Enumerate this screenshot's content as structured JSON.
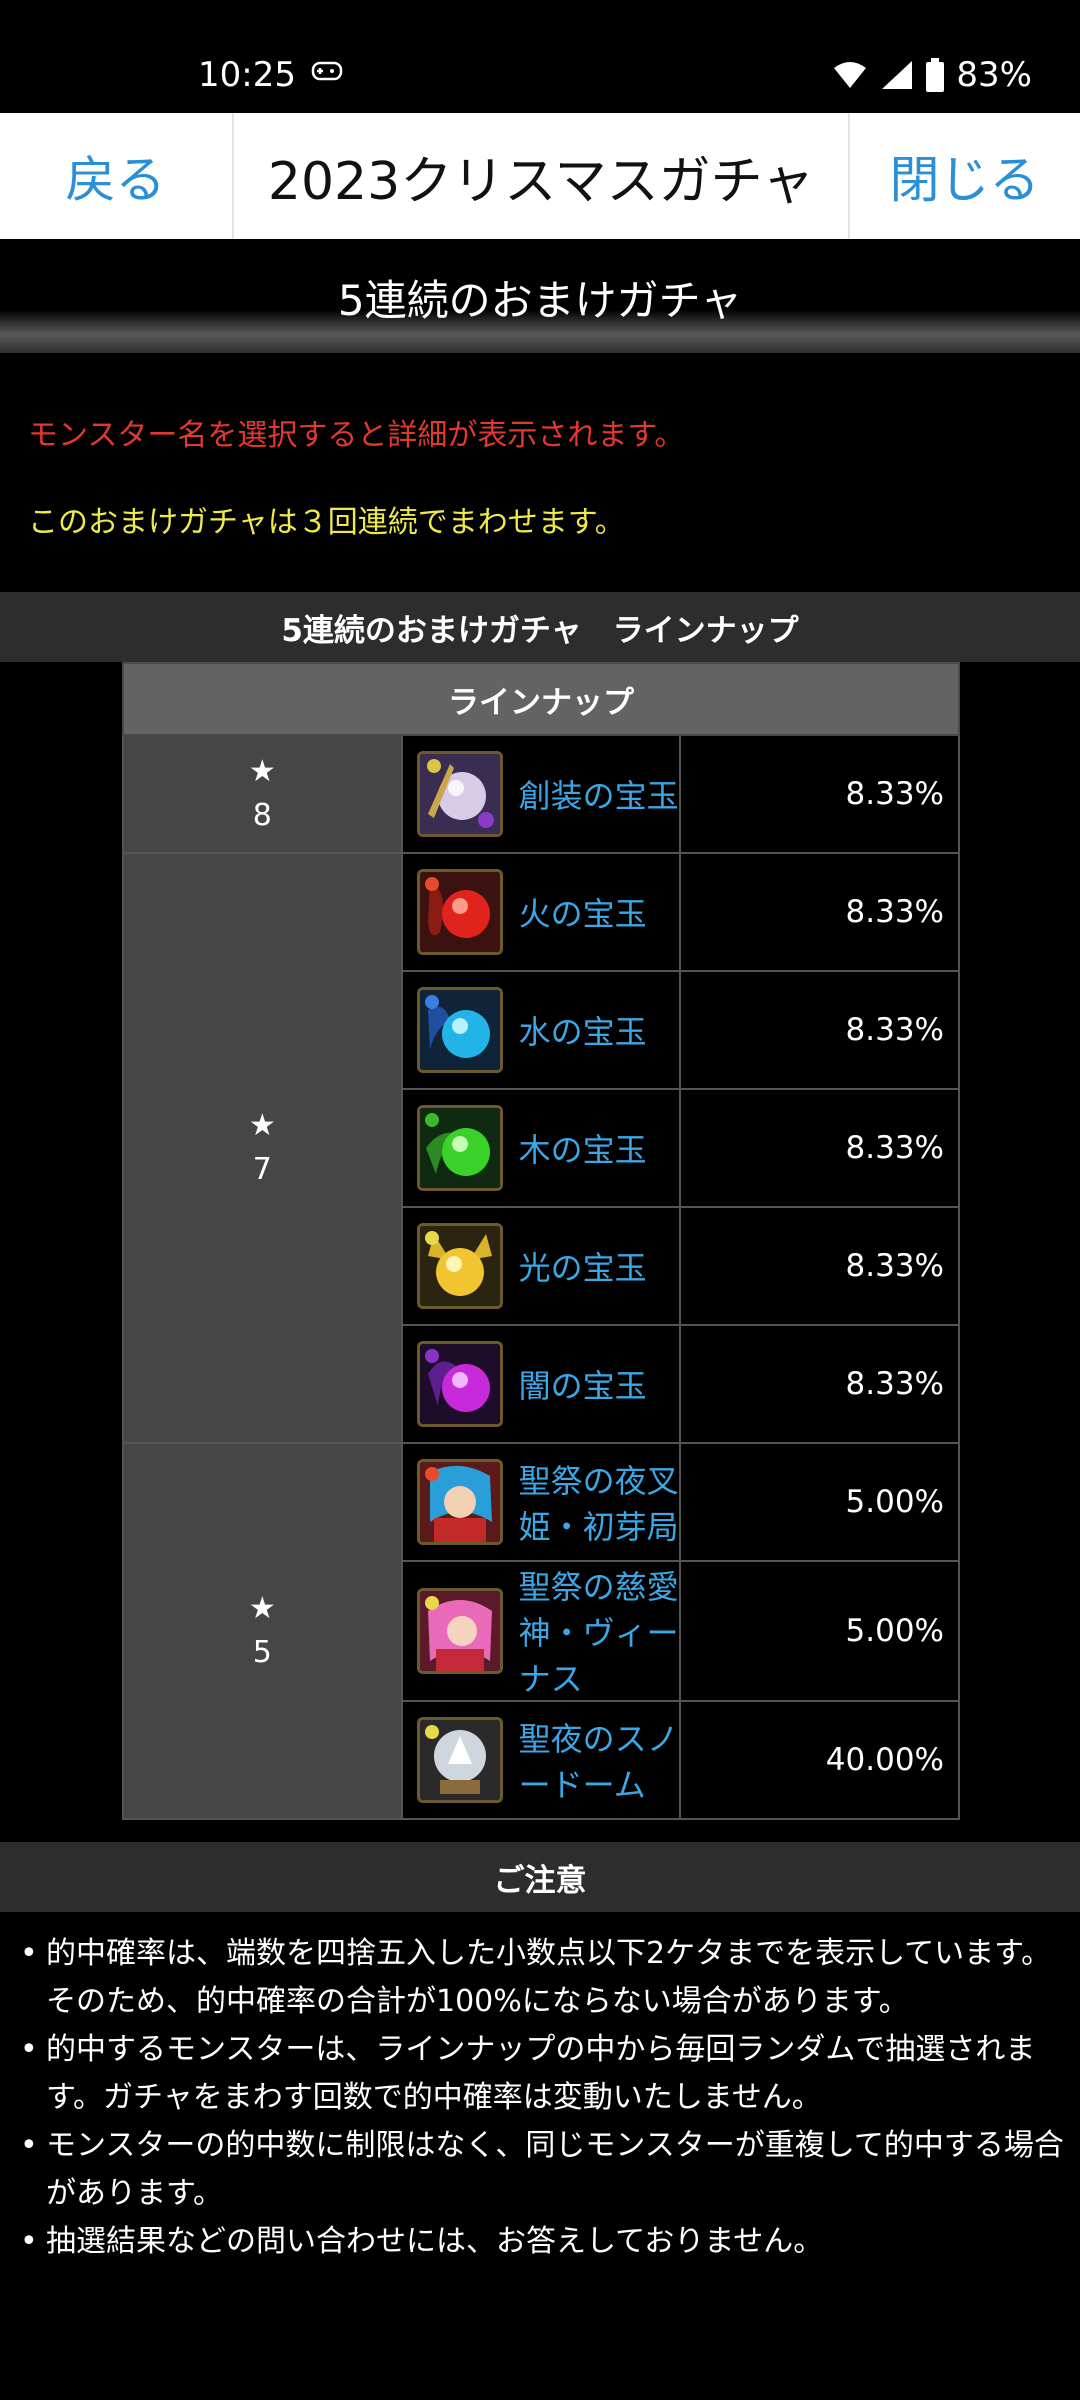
{
  "status_bar": {
    "time": "10:25",
    "battery": "83%"
  },
  "nav": {
    "back_label": "戻る",
    "title": "2023クリスマスガチャ",
    "close_label": "閉じる"
  },
  "header": {
    "title": "5連続のおまけガチャ"
  },
  "notices": {
    "red": "モンスター名を選択すると詳細が表示されます。",
    "yellow": "このおまけガチャは３回連続でまわせます。"
  },
  "lineup_section": {
    "title": "5連続のおまけガチャ　ラインナップ"
  },
  "table": {
    "header": "ラインナップ",
    "groups": [
      {
        "star": "★",
        "rarity": "8",
        "items": [
          {
            "name": "創装の宝玉",
            "rate": "8.33%",
            "icon": "creation-orb-icon"
          }
        ]
      },
      {
        "star": "★",
        "rarity": "7",
        "items": [
          {
            "name": "火の宝玉",
            "rate": "8.33%",
            "icon": "fire-orb-icon"
          },
          {
            "name": "水の宝玉",
            "rate": "8.33%",
            "icon": "water-orb-icon"
          },
          {
            "name": "木の宝玉",
            "rate": "8.33%",
            "icon": "wood-orb-icon"
          },
          {
            "name": "光の宝玉",
            "rate": "8.33%",
            "icon": "light-orb-icon"
          },
          {
            "name": "闇の宝玉",
            "rate": "8.33%",
            "icon": "dark-orb-icon"
          }
        ]
      },
      {
        "star": "★",
        "rarity": "5",
        "items": [
          {
            "name": "聖祭の夜叉姫・初芽局",
            "rate": "5.00%",
            "icon": "yasha-princess-icon"
          },
          {
            "name": "聖祭の慈愛神・ヴィーナス",
            "rate": "5.00%",
            "icon": "venus-icon"
          },
          {
            "name": "聖夜のスノードーム",
            "rate": "40.00%",
            "icon": "snow-globe-icon"
          }
        ]
      }
    ]
  },
  "notes_section": {
    "title": "ご注意",
    "items": [
      "的中確率は、端数を四捨五入した小数点以下2ケタまでを表示しています。そのため、的中確率の合計が100%にならない場合があります。",
      "的中するモンスターは、ラインナップの中から毎回ランダムで抽選されます。ガチャをまわす回数で的中確率は変動いたしません。",
      "モンスターの的中数に制限はなく、同じモンスターが重複して的中する場合があります。",
      "抽選結果などの問い合わせには、お答えしておりません。"
    ]
  },
  "colors": {
    "link": "#3aa7e6",
    "nav_link": "#2a8fd6",
    "notice_red": "#e1392f",
    "notice_yellow": "#efe94a"
  }
}
